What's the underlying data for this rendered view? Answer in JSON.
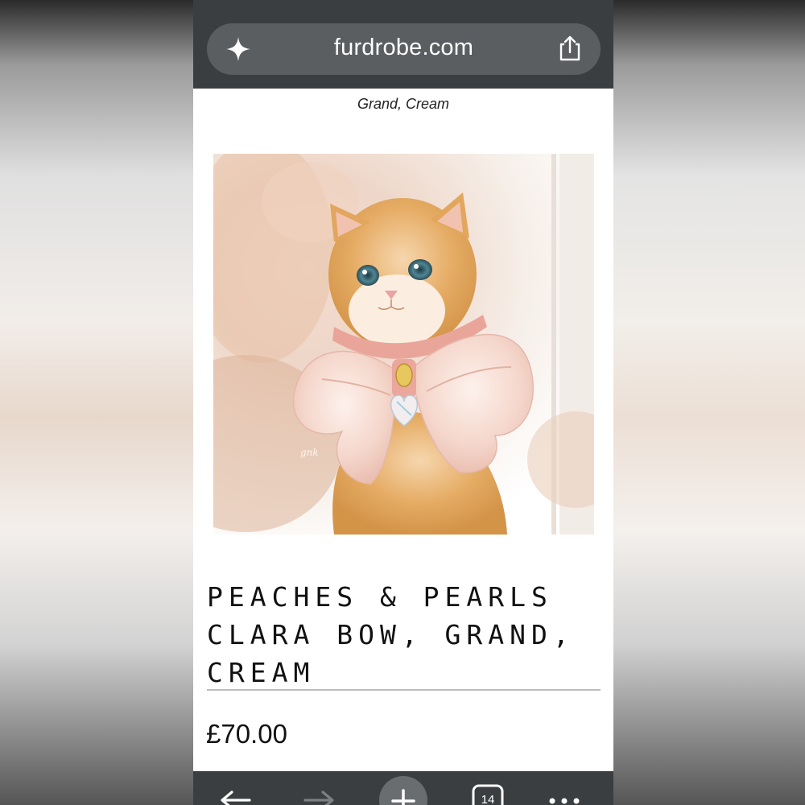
{
  "browser": {
    "url": "furdrobe.com",
    "tabs_count": "14"
  },
  "product": {
    "variant_caption": "Grand, Cream",
    "title_lines": [
      "PEACHES & PEARLS",
      "CLARA BOW, GRAND,",
      "CREAM"
    ],
    "price": "£70.00"
  },
  "icons": {
    "sparkle": "sparkle-icon",
    "share": "share-icon",
    "back": "back-arrow-icon",
    "forward": "forward-arrow-icon",
    "new_tab": "plus-icon",
    "tabs": "tabs-icon",
    "more": "more-dots-icon"
  },
  "colors": {
    "browser_chrome": "#3b3e40",
    "url_pill": "#5b5e61",
    "cat_fur": "#e3a95f",
    "bow": "#f7dcd3"
  }
}
